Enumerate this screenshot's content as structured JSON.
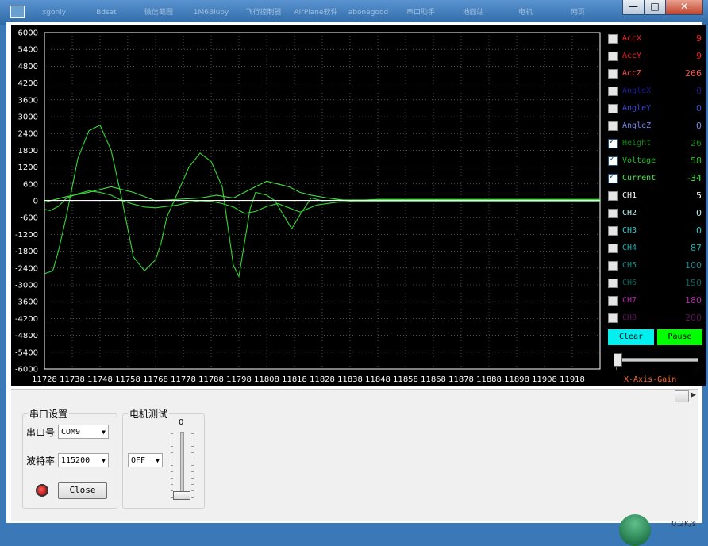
{
  "taskbar": {
    "items": [
      "xgonly",
      "Bdsat",
      "微信截图",
      "1M6Bluoy",
      "飞行控制器",
      "AirPlane软件",
      "abonegood",
      "串口助手",
      "地面站",
      "电机",
      "网页"
    ]
  },
  "window": {
    "minimize": "—",
    "maximize": "□",
    "close": "✕"
  },
  "chart_data": {
    "type": "line",
    "title": "",
    "xlabel": "",
    "ylabel": "",
    "x_ticks": [
      "11728",
      "11738",
      "11748",
      "11758",
      "11768",
      "11778",
      "11788",
      "11798",
      "11808",
      "11818",
      "11828",
      "11838",
      "11848",
      "11858",
      "11868",
      "11878",
      "11888",
      "11898",
      "11908",
      "11918"
    ],
    "y_ticks": [
      "6000",
      "5400",
      "4800",
      "4200",
      "3600",
      "3000",
      "2400",
      "1800",
      "1200",
      "600",
      "0",
      "-600",
      "-1200",
      "-1800",
      "-2400",
      "-3000",
      "-3600",
      "-4200",
      "-4800",
      "-5400",
      "-6000"
    ],
    "ylim": [
      -6000,
      6000
    ],
    "xlim": [
      11728,
      11928
    ],
    "grid": true,
    "series": [
      {
        "name": "Height",
        "color": "#36d636",
        "x": [
          11728,
          11730,
          11733,
          11736,
          11740,
          11744,
          11748,
          11752,
          11756,
          11760,
          11764,
          11768,
          11772,
          11776,
          11780,
          11784,
          11788,
          11792,
          11796,
          11800,
          11804,
          11808,
          11812,
          11816,
          11820,
          11826,
          11834,
          11842,
          11928
        ],
        "y": [
          -300,
          -350,
          -200,
          100,
          250,
          350,
          300,
          200,
          0,
          -120,
          -220,
          -250,
          -200,
          -150,
          -50,
          0,
          -20,
          -100,
          -220,
          -450,
          -380,
          -200,
          -100,
          -250,
          -400,
          -150,
          -40,
          -20,
          -20
        ]
      },
      {
        "name": "Voltage",
        "color": "#33d633",
        "x": [
          11728,
          11731,
          11733,
          11736,
          11740,
          11744,
          11748,
          11752,
          11756,
          11760,
          11764,
          11768,
          11770,
          11772,
          11776,
          11780,
          11784,
          11788,
          11792,
          11796,
          11798,
          11800,
          11802,
          11804,
          11808,
          11811,
          11814,
          11817,
          11820,
          11824,
          11828,
          11834,
          11928
        ],
        "y": [
          -2600,
          -2500,
          -1800,
          -500,
          1500,
          2500,
          2700,
          1800,
          0,
          -2000,
          -2500,
          -2100,
          -1500,
          -600,
          300,
          1200,
          1700,
          1400,
          500,
          -2300,
          -2700,
          -1500,
          -300,
          300,
          200,
          0,
          -500,
          -1000,
          -500,
          100,
          0,
          30,
          30
        ]
      },
      {
        "name": "Current",
        "color": "#42dd42",
        "x": [
          11728,
          11736,
          11744,
          11752,
          11760,
          11768,
          11776,
          11784,
          11790,
          11796,
          11800,
          11804,
          11808,
          11812,
          11816,
          11820,
          11824,
          11830,
          11838,
          11848,
          11928
        ],
        "y": [
          -50,
          150,
          300,
          500,
          300,
          0,
          50,
          100,
          200,
          100,
          300,
          500,
          700,
          600,
          500,
          300,
          200,
          100,
          0,
          50,
          50
        ]
      },
      {
        "name": "CH1",
        "color": "#ffffff",
        "x": [
          11728,
          11928
        ],
        "y": [
          10,
          10
        ]
      }
    ]
  },
  "channels": [
    {
      "name": "AccX",
      "value": "9",
      "checked": false,
      "color": "#ff2020"
    },
    {
      "name": "AccY",
      "value": "9",
      "checked": false,
      "color": "#ff2020"
    },
    {
      "name": "AccZ",
      "value": "266",
      "checked": false,
      "color": "#ff4a4a"
    },
    {
      "name": "AngleX",
      "value": "0",
      "checked": false,
      "color": "#1a1aa0"
    },
    {
      "name": "AngleY",
      "value": "0",
      "checked": false,
      "color": "#3a4ad6"
    },
    {
      "name": "AngleZ",
      "value": "0",
      "checked": false,
      "color": "#7a86f0"
    },
    {
      "name": "Height",
      "value": "26",
      "checked": true,
      "color": "#0f8a0f"
    },
    {
      "name": "Voltage",
      "value": "58",
      "checked": true,
      "color": "#1fbf1f"
    },
    {
      "name": "Current",
      "value": "-34",
      "checked": true,
      "color": "#44ee44"
    },
    {
      "name": "CH1",
      "value": "5",
      "checked": false,
      "color": "#ffffff"
    },
    {
      "name": "CH2",
      "value": "0",
      "checked": false,
      "color": "#b8f0f0"
    },
    {
      "name": "CH3",
      "value": "0",
      "checked": false,
      "color": "#2fd0d0"
    },
    {
      "name": "CH4",
      "value": "87",
      "checked": false,
      "color": "#1ab0b0"
    },
    {
      "name": "CH5",
      "value": "100",
      "checked": false,
      "color": "#0f8b8b"
    },
    {
      "name": "CH6",
      "value": "150",
      "checked": false,
      "color": "#0c6262"
    },
    {
      "name": "CH7",
      "value": "180",
      "checked": false,
      "color": "#b02aa8"
    },
    {
      "name": "CH8",
      "value": "200",
      "checked": false,
      "color": "#5a1656"
    }
  ],
  "buttons": {
    "clear": "Clear",
    "pause": "Pause"
  },
  "x_axis_gain": {
    "label": "X-Axis-Gain",
    "level": 0.0
  },
  "serial_group": {
    "title": "串口设置",
    "port_label": "串口号",
    "port_value": "COM9",
    "baud_label": "波特率",
    "baud_value": "115200",
    "close_label": "Close",
    "status_led_color": "#d01010"
  },
  "motor_group": {
    "title": "电机测试",
    "slider_value": "0",
    "mode_value": "OFF"
  },
  "tray": {
    "rate": "0.2K/s"
  }
}
